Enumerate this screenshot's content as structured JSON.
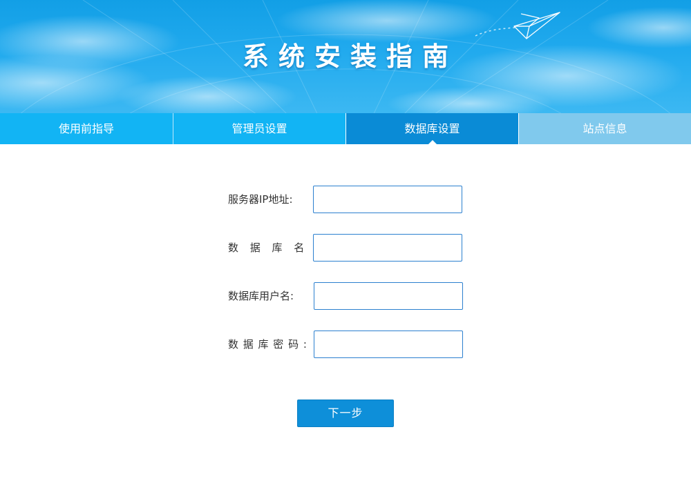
{
  "header": {
    "title": "系统安装指南"
  },
  "tabs": [
    {
      "label": "使用前指导",
      "state": "completed"
    },
    {
      "label": "管理员设置",
      "state": "completed"
    },
    {
      "label": "数据库设置",
      "state": "active"
    },
    {
      "label": "站点信息",
      "state": "upcoming"
    }
  ],
  "form": {
    "fields": [
      {
        "label": "服务器IP地址:",
        "value": "",
        "placeholder": ""
      },
      {
        "label": "数 据 库 名 :",
        "value": "",
        "placeholder": ""
      },
      {
        "label": "数据库用户名:",
        "value": "",
        "placeholder": ""
      },
      {
        "label": "数 据 库 密 码 :",
        "value": "",
        "placeholder": ""
      }
    ],
    "next_label": "下一步"
  },
  "colors": {
    "banner_blue": "#1fa8ec",
    "tab_blue": "#12b4f4",
    "tab_active": "#0a8bd6",
    "tab_upcoming": "#80c9ed",
    "input_border": "#2a7fcf",
    "button_blue": "#0e8fd9"
  },
  "icons": {
    "banner_decoration": "paper-plane-icon"
  }
}
